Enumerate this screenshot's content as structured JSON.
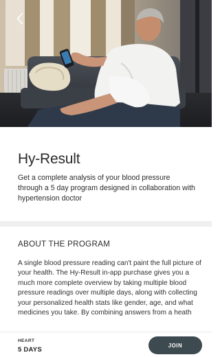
{
  "hero": {
    "image": "man-measuring-blood-pressure-photo",
    "back_icon": "chevron-left-icon"
  },
  "header": {
    "title": "Hy-Result",
    "subtitle": "Get a complete analysis of your blood pressure through a 5 day program designed in collaboration with hypertension doctor"
  },
  "about": {
    "heading": "ABOUT THE PROGRAM",
    "body": "A single blood pressure reading can't paint the full picture of your health. The Hy-Result in-app purchase gives you a much more complete overview by taking multiple blood pressure readings over multiple days, along with collecting your personalized health stats like gender, age, and what medicines you take. By combining answers from a heath"
  },
  "footer": {
    "category": "HEART",
    "duration": "5 DAYS",
    "join_label": "JOIN"
  },
  "colors": {
    "join_button": "#3d4a4f",
    "divider": "#efefef",
    "text": "#2a2a2a"
  }
}
